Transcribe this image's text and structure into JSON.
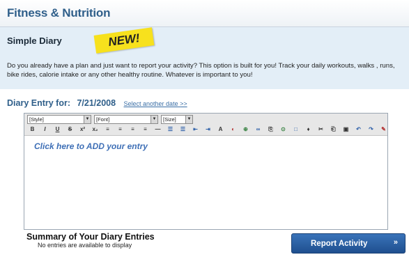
{
  "header": {
    "title": "Fitness & Nutrition"
  },
  "diary": {
    "subtitle": "Simple Diary",
    "badge": "NEW!",
    "description": "Do you already have a plan and just want to report your activity? This option is built for you! Track your daily workouts, walks , runs, bike rides, calorie intake or any other healthy routine. Whatever is important to you!"
  },
  "entry": {
    "label": "Diary Entry for:",
    "date": "7/21/2008",
    "link": "Select another date",
    "link_arrow": ">>"
  },
  "editor": {
    "style_select": "[Style]",
    "font_select": "[Font]",
    "size_select": "[Size]",
    "placeholder": "Click here to ADD your entry",
    "toolbar_buttons": [
      "B",
      "I",
      "U",
      "S",
      "x²",
      "x₂",
      "≡",
      "≡",
      "≡",
      "≡",
      "—",
      "☰",
      "☰",
      "⇤",
      "⇥",
      "A",
      "◐",
      "⊕",
      "∞",
      "⎘",
      "⊙",
      "□",
      "♦",
      "✂",
      "⎗",
      "▣",
      "↶",
      "↷",
      "✎"
    ]
  },
  "summary": {
    "title": "Summary of Your Diary Entries",
    "subtitle": "No entries are available to display"
  },
  "actions": {
    "report_label": "Report Activity",
    "report_arrow": "»"
  },
  "colors": {
    "title": "#2f5f8a",
    "panel_bg": "#e3eef7",
    "badge": "#f7e11d",
    "button": "#2a62a6"
  }
}
